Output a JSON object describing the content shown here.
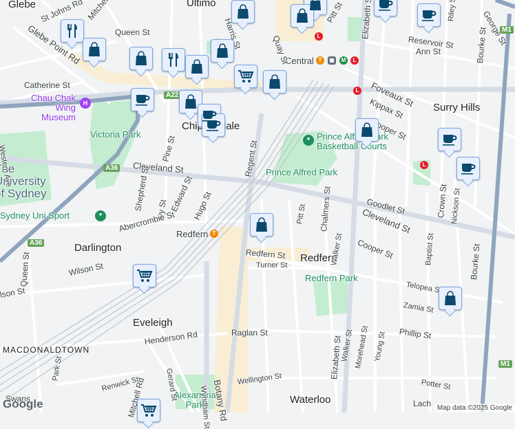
{
  "areas": {
    "glebe": "Glebe",
    "ultimo": "Ultimo",
    "surry_hills": "Surry Hills",
    "chippendale": "Chippendale",
    "darlington": "Darlington",
    "redfern": "Redfern",
    "eveleigh": "Eveleigh",
    "waterloo": "Waterloo",
    "macdonaldtown": "MACDONALDTOWN"
  },
  "pois": {
    "museum": "Chau Chak Wing Museum",
    "victoria_park": "Victoria Park",
    "uni": "The University of Sydney",
    "uni_sport": "Sydney Uni Sport",
    "prince_alfred": "Prince Alfred Park",
    "basketball": "Prince Alfred Park Basketball Courts",
    "redfern_park": "Redfern Park",
    "alexandria_park": "Alexandria Park",
    "central": "Central",
    "redfern_station": "Redfern"
  },
  "streets": {
    "st_johns": "St Johns Rd",
    "mitchell": "Mitchell",
    "glebe_point": "Glebe Point Rd",
    "queen": "Queen St",
    "catherine": "Catherine St",
    "cleveland": "Cleveland St",
    "cleveland2": "Cleveland St",
    "regent": "Regent St",
    "pine": "Pine St",
    "shepherd": "Shepherd St",
    "ivy": "Ivy St",
    "edward": "Edward St",
    "hugo": "Hugo St",
    "abercrombie": "Abercrombie St",
    "queen2": "Queen St",
    "wilson": "Wilson St",
    "wilson2": "lson St",
    "redfern_st": "Redfern St",
    "turner": "Turner St",
    "pitt": "Pitt St",
    "pitt2": "Pitt St",
    "chalmers": "Chalmers St",
    "elizabeth": "Elizabeth St",
    "elizabeth2": "Elizabeth St",
    "quay": "Quay St",
    "foveaux": "Foveaux St",
    "kippax": "Kippax St",
    "cooper": "Cooper St",
    "cooper2": "Cooper St",
    "goodlet": "Goodlet St",
    "reservoir": "Reservoir St",
    "ann": "Ann St",
    "bourke": "Bourke St",
    "bourke2": "Bourke St",
    "crown": "Crown St",
    "nickson": "Nickson St",
    "baptist": "Baptist St",
    "telopea": "Telopea St",
    "zamia": "Zamia St",
    "phillip": "Phillip St",
    "raglan": "Raglan St",
    "henderson": "Henderson Rd",
    "botany": "Botany Rd",
    "wyndham": "Wyndham St",
    "gerard": "Gerard St",
    "walker": "Walker St",
    "walker2": "Walker St",
    "morehead": "Morehead St",
    "young": "Young St",
    "wellington": "Wellington St",
    "renwick": "Renwick St",
    "potter": "Potter St",
    "park": "Park St",
    "mitchell_rd": "Mitchell Rd",
    "swanson": "Swans",
    "lach": "Lach",
    "harris": "Harris St",
    "eastern": "Western Ave",
    "george": "George St",
    "riley": "Riley St"
  },
  "shields": {
    "a22": "A22",
    "a36": "A36",
    "a36b": "A36",
    "m1": "M1",
    "m1b": "M1"
  },
  "stations": {
    "t": "T",
    "m": "M",
    "l": "L"
  },
  "footer": {
    "attribution": "Map data ©2025 Google",
    "logo": "Google"
  },
  "colors": {
    "marker_fill": "#e8f0fe",
    "marker_icon": "#0b4a6e",
    "park": "#c4ecd0",
    "road_major": "#8fa4bd"
  }
}
